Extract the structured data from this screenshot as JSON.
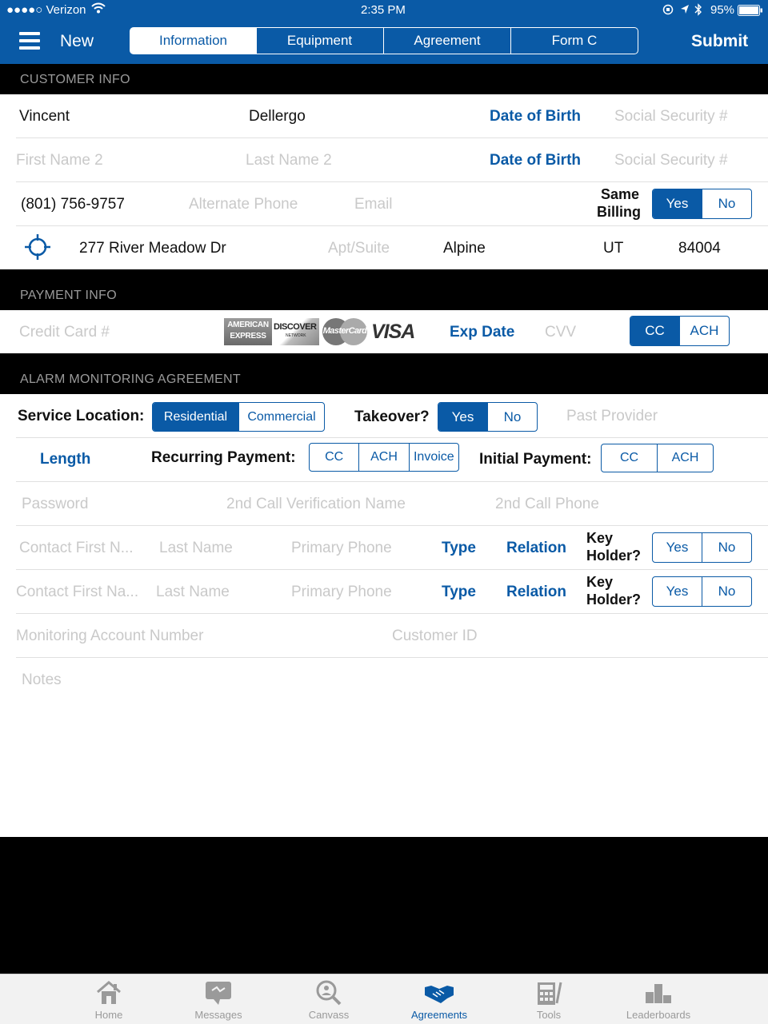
{
  "status_bar": {
    "carrier": "●●●●○ Verizon",
    "time": "2:35 PM",
    "battery": "95%"
  },
  "nav": {
    "title": "New",
    "submit": "Submit",
    "tabs": [
      "Information",
      "Equipment",
      "Agreement",
      "Form C"
    ],
    "active_tab": "Information"
  },
  "customer_info": {
    "header": "CUSTOMER INFO",
    "first_name": "Vincent",
    "last_name": "Dellergo",
    "dob_label": "Date of Birth",
    "ssn_placeholder": "Social Security #",
    "first_name2_placeholder": "First Name 2",
    "last_name2_placeholder": "Last Name 2",
    "dob2_label": "Date of Birth",
    "ssn2_placeholder": "Social Security #",
    "phone": "(801) 756-9757",
    "alt_phone_placeholder": "Alternate Phone",
    "email_placeholder": "Email",
    "same_billing_line1": "Same",
    "same_billing_line2": "Billing",
    "same_billing_yes": "Yes",
    "same_billing_no": "No",
    "same_billing_selected": "Yes",
    "address": "277 River Meadow Dr",
    "apt_placeholder": "Apt/Suite",
    "city": "Alpine",
    "state": "UT",
    "zip": "84004"
  },
  "payment_info": {
    "header": "PAYMENT INFO",
    "cc_placeholder": "Credit Card #",
    "card_logos": {
      "amex_line1": "AMERICAN",
      "amex_line2": "EXPRESS",
      "discover": "DISCOVER",
      "discover_sub": "NETWORK",
      "mastercard": "MasterCard",
      "visa": "VISA"
    },
    "exp_label": "Exp Date",
    "cvv_placeholder": "CVV",
    "method_cc": "CC",
    "method_ach": "ACH",
    "method_selected": "CC"
  },
  "agreement": {
    "header": "ALARM MONITORING AGREEMENT",
    "service_location_label": "Service Location:",
    "residential": "Residential",
    "commercial": "Commercial",
    "service_selected": "Residential",
    "takeover_label": "Takeover?",
    "takeover_yes": "Yes",
    "takeover_no": "No",
    "takeover_selected": "Yes",
    "past_provider_placeholder": "Past Provider",
    "length_label": "Length",
    "recurring_label": "Recurring Payment:",
    "recurring_cc": "CC",
    "recurring_ach": "ACH",
    "recurring_invoice": "Invoice",
    "initial_label": "Initial Payment:",
    "initial_cc": "CC",
    "initial_ach": "ACH",
    "password_placeholder": "Password",
    "verification_name_placeholder": "2nd Call Verification Name",
    "call_phone_placeholder": "2nd Call Phone",
    "contacts": [
      {
        "first_placeholder": "Contact First N...",
        "last_placeholder": "Last Name",
        "phone_placeholder": "Primary Phone",
        "type_label": "Type",
        "relation_label": "Relation",
        "key_holder_line1": "Key",
        "key_holder_line2": "Holder?",
        "yes": "Yes",
        "no": "No"
      },
      {
        "first_placeholder": "Contact First Na...",
        "last_placeholder": "Last Name",
        "phone_placeholder": "Primary Phone",
        "type_label": "Type",
        "relation_label": "Relation",
        "key_holder_line1": "Key",
        "key_holder_line2": "Holder?",
        "yes": "Yes",
        "no": "No"
      }
    ],
    "monitoring_account_placeholder": "Monitoring Account Number",
    "customer_id_placeholder": "Customer ID",
    "notes_placeholder": "Notes"
  },
  "tab_bar": {
    "items": [
      {
        "label": "Home",
        "icon": "home-icon"
      },
      {
        "label": "Messages",
        "icon": "messages-icon"
      },
      {
        "label": "Canvass",
        "icon": "search-icon"
      },
      {
        "label": "Agreements",
        "icon": "handshake-icon"
      },
      {
        "label": "Tools",
        "icon": "calculator-icon"
      },
      {
        "label": "Leaderboards",
        "icon": "leaderboard-icon"
      }
    ],
    "active": "Agreements"
  },
  "colors": {
    "brand_blue": "#0a5aa6",
    "placeholder_gray": "#c9c9c9",
    "header_black": "#000000"
  }
}
